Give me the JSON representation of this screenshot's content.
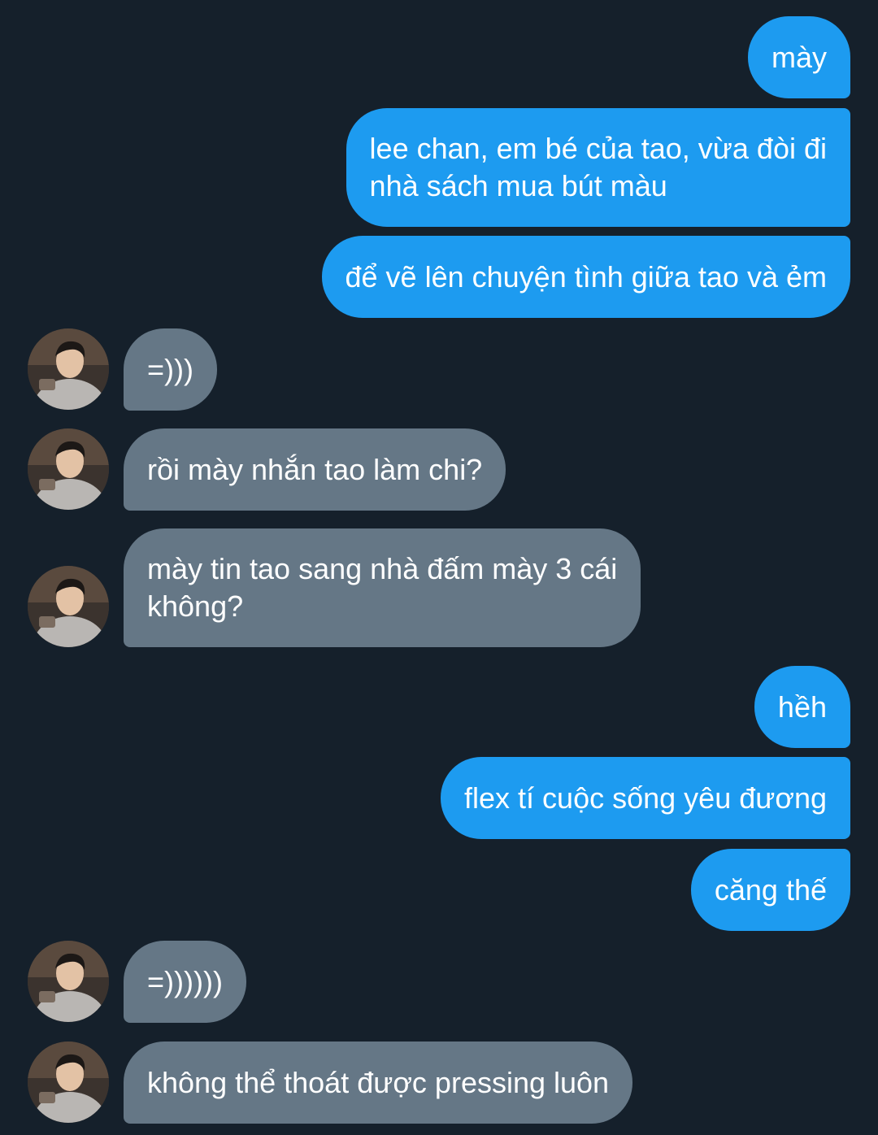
{
  "colors": {
    "background": "#15202b",
    "outgoing_bubble": "#1d9bf0",
    "incoming_bubble": "#657786",
    "text": "#ffffff"
  },
  "messages": [
    {
      "sender": "me",
      "text": "mày"
    },
    {
      "sender": "me",
      "text": "lee chan, em bé của tao, vừa đòi đi\nnhà sách mua bút màu"
    },
    {
      "sender": "me",
      "text": "để vẽ lên chuyện tình giữa tao và ẻm"
    },
    {
      "sender": "them",
      "text": "=)))",
      "avatar": "contact-avatar"
    },
    {
      "sender": "them",
      "text": "rồi mày nhắn tao làm chi?",
      "avatar": "contact-avatar"
    },
    {
      "sender": "them",
      "text": "mày tin tao sang nhà đấm mày 3 cái\nkhông?",
      "avatar": "contact-avatar"
    },
    {
      "sender": "me",
      "text": "hềh"
    },
    {
      "sender": "me",
      "text": "flex tí cuộc sống yêu đương"
    },
    {
      "sender": "me",
      "text": "căng thế"
    },
    {
      "sender": "them",
      "text": "=))))))",
      "avatar": "contact-avatar"
    },
    {
      "sender": "them",
      "text": "không thể thoát được pressing luôn",
      "avatar": "contact-avatar"
    }
  ]
}
